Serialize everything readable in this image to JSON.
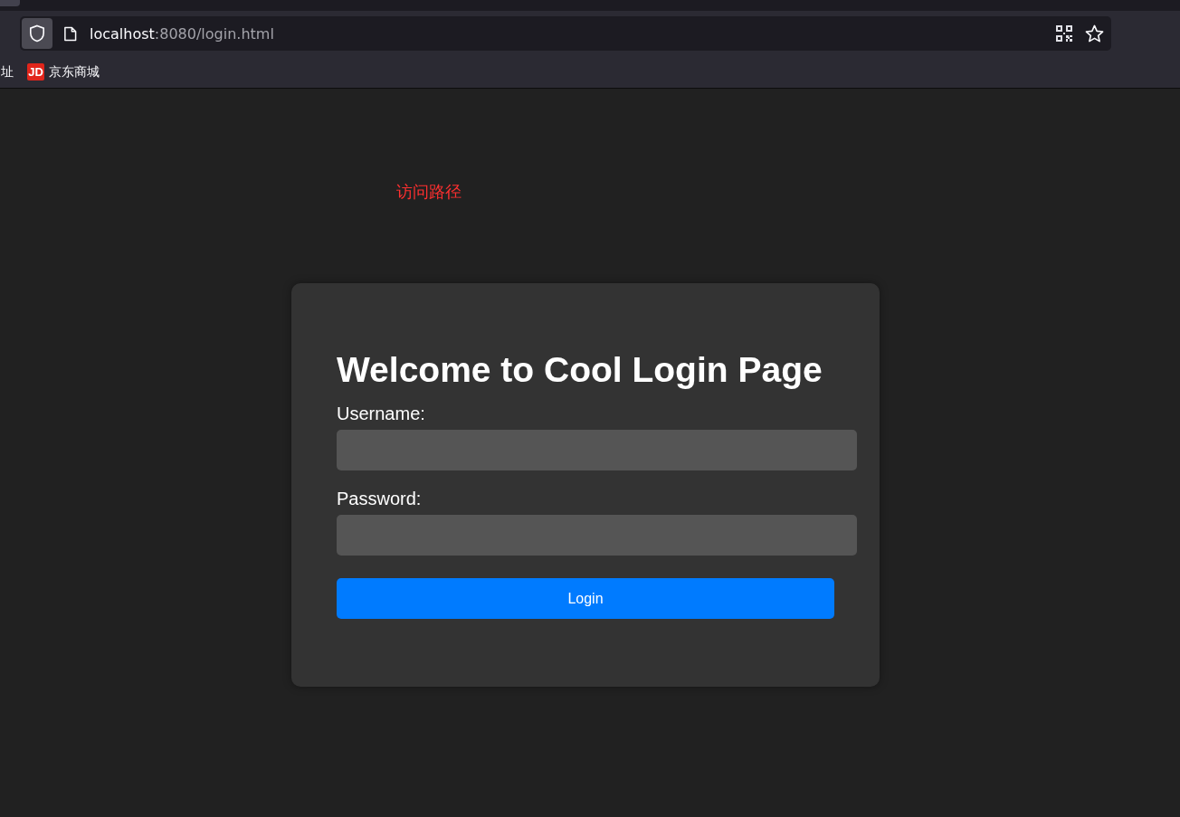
{
  "browser": {
    "address": {
      "host": "localhost",
      "path": ":8080/login.html"
    },
    "bookmarks": [
      {
        "label": "址",
        "kind": "plain"
      },
      {
        "label": "京东商城",
        "kind": "jd",
        "logo": "JD"
      }
    ]
  },
  "annotation": "访问路径",
  "login_card": {
    "title": "Welcome to Cool Login Page",
    "fields": [
      {
        "label": "Username:"
      },
      {
        "label": "Password:"
      }
    ],
    "button": "Login"
  }
}
